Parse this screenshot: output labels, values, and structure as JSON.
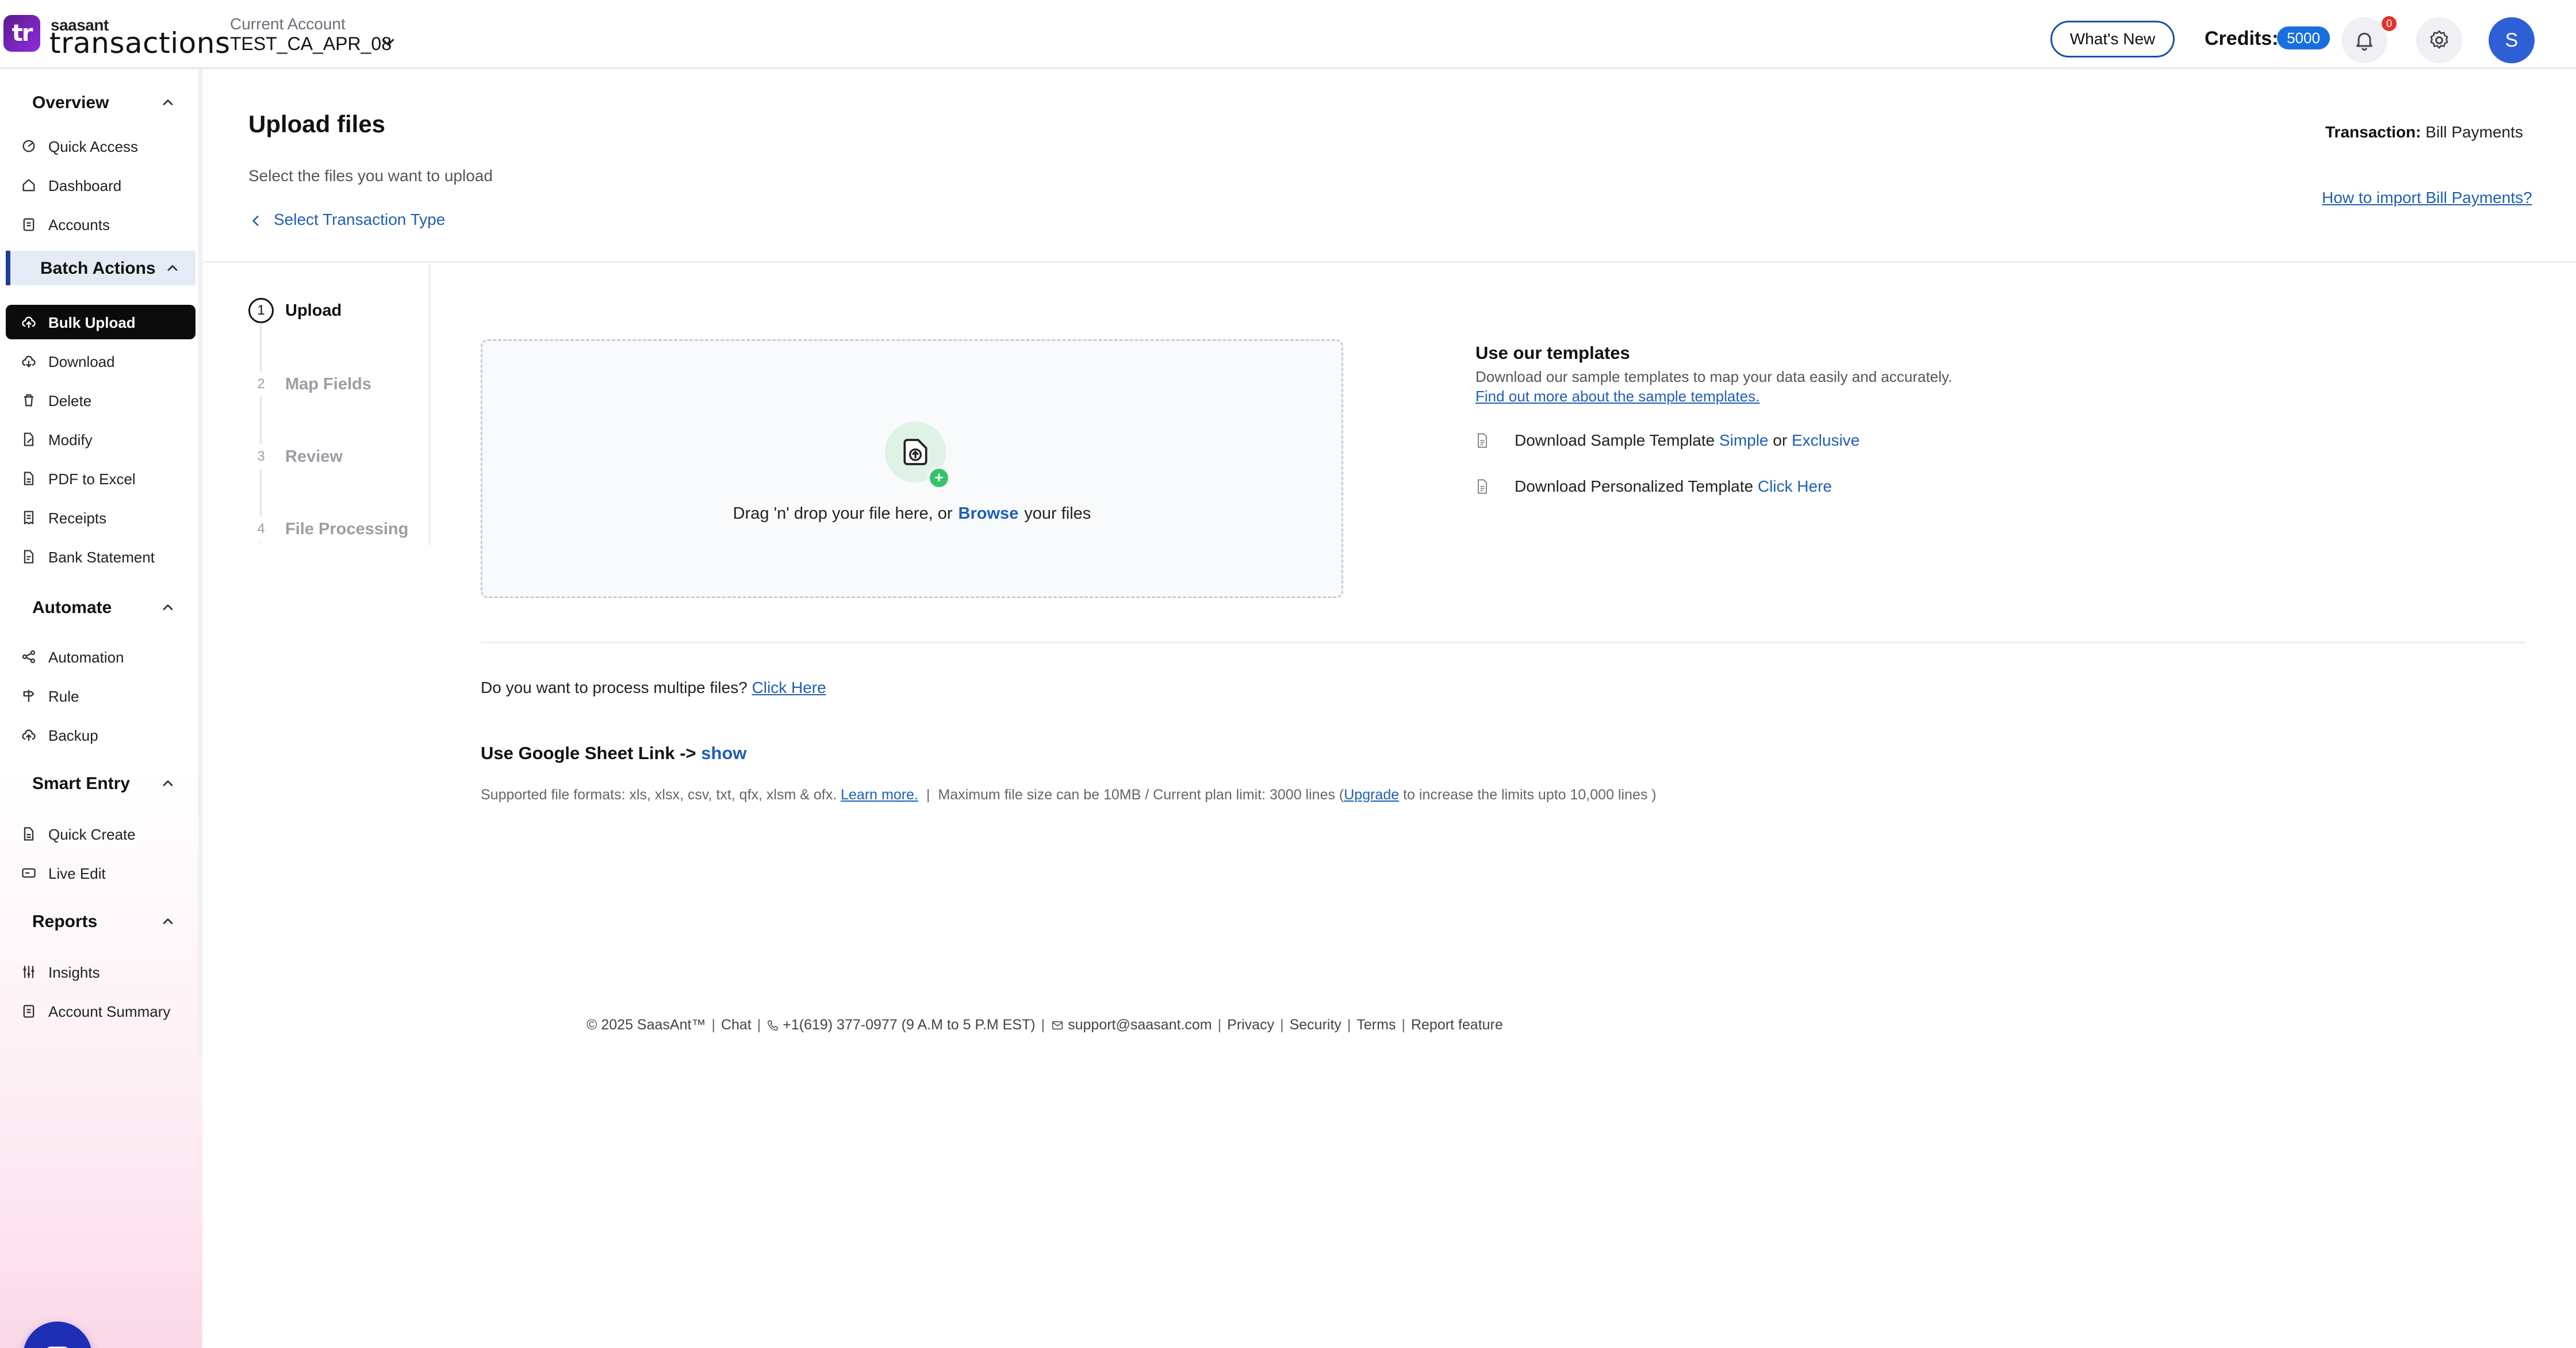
{
  "header": {
    "logo_small": "saasant",
    "logo_big": "transactions",
    "logo_mark": "tr",
    "account_label": "Current Account",
    "account_name": "TEST_CA_APR_08",
    "whats_new": "What's New",
    "credits_label": "Credits:",
    "credits_value": "5000",
    "notifications_count": "0",
    "avatar_letter": "S"
  },
  "sidebar": {
    "sections": {
      "overview": "Overview",
      "batch_actions": "Batch Actions",
      "automate": "Automate",
      "smart_entry": "Smart Entry",
      "reports": "Reports"
    },
    "items": {
      "quick_access": "Quick Access",
      "dashboard": "Dashboard",
      "accounts": "Accounts",
      "bulk_upload": "Bulk Upload",
      "download": "Download",
      "delete": "Delete",
      "modify": "Modify",
      "pdf_to_excel": "PDF to Excel",
      "receipts": "Receipts",
      "bank_statement": "Bank Statement",
      "automation": "Automation",
      "rule": "Rule",
      "backup": "Backup",
      "quick_create": "Quick Create",
      "live_edit": "Live Edit",
      "insights": "Insights",
      "account_summary": "Account Summary"
    }
  },
  "main": {
    "title": "Upload files",
    "subtitle": "Select the files you want to upload",
    "back_link": "Select Transaction Type",
    "transaction_label": "Transaction:",
    "transaction_value": "Bill Payments",
    "howto_link": "How to import Bill Payments?",
    "steps": [
      {
        "num": "1",
        "label": "Upload"
      },
      {
        "num": "2",
        "label": "Map Fields"
      },
      {
        "num": "3",
        "label": "Review"
      },
      {
        "num": "4",
        "label": "File Processing"
      }
    ],
    "dropzone": {
      "prefix": "Drag 'n' drop your file here, or",
      "browse": "Browse",
      "suffix": "your files"
    },
    "templates": {
      "title": "Use our templates",
      "desc": "Download our sample templates to map your data easily and accurately.",
      "more_link": "Find out more about the sample templates.",
      "sample_prefix": "Download Sample Template",
      "simple": "Simple",
      "or": "or",
      "exclusive": "Exclusive",
      "personal_prefix": "Download Personalized Template",
      "click_here": "Click Here"
    },
    "multi": {
      "question": "Do you want to process multipe files?",
      "link": "Click Here"
    },
    "gsheet": {
      "label": "Use Google Sheet Link ->",
      "link": "show"
    },
    "formats": {
      "text": "Supported file formats: xls, xlsx, csv, txt, qfx, xlsm & ofx.",
      "learn_more": "Learn more.",
      "sep": "|",
      "limit_prefix": "Maximum file size can be 10MB / Current plan limit: 3000 lines (",
      "upgrade": "Upgrade",
      "limit_suffix": "to increase the limits upto 10,000 lines )"
    }
  },
  "footer": {
    "copyright": "© 2025 SaasAnt™",
    "chat": "Chat",
    "phone": "+1(619) 377-0977 (9 A.M to 5 P.M EST)",
    "email": "support@saasant.com",
    "privacy": "Privacy",
    "security": "Security",
    "terms": "Terms",
    "report": "Report feature",
    "sep": "|"
  }
}
